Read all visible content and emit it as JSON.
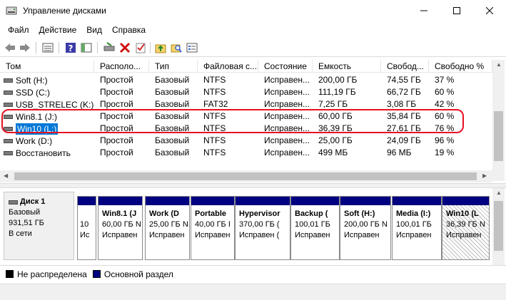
{
  "window": {
    "title": "Управление дисками",
    "icons": {
      "app": "disk-management-icon",
      "minimize": "minimize-icon",
      "maximize": "maximize-icon",
      "close": "close-icon"
    }
  },
  "menu": [
    "Файл",
    "Действие",
    "Вид",
    "Справка"
  ],
  "toolbar": {
    "icons": [
      "back-arrow-icon",
      "forward-arrow-icon",
      "properties-list-icon",
      "help-icon",
      "console-tree-icon",
      "connect-drive-icon",
      "delete-icon",
      "check-icon",
      "up-folder-icon",
      "search-folder-icon",
      "list-view-icon"
    ]
  },
  "columns": [
    "Том",
    "Располо...",
    "Тип",
    "Файловая с...",
    "Состояние",
    "Емкость",
    "Свобод...",
    "Свободно %"
  ],
  "volumes": [
    {
      "name": "Soft (H:)",
      "layout": "Простой",
      "type": "Базовый",
      "fs": "NTFS",
      "status": "Исправен...",
      "capacity": "200,00 ГБ",
      "free": "74,55 ГБ",
      "free_pct": "37 %"
    },
    {
      "name": "SSD (C:)",
      "layout": "Простой",
      "type": "Базовый",
      "fs": "NTFS",
      "status": "Исправен...",
      "capacity": "111,19 ГБ",
      "free": "66,72 ГБ",
      "free_pct": "60 %"
    },
    {
      "name": "USB_STRELEC (K:)",
      "layout": "Простой",
      "type": "Базовый",
      "fs": "FAT32",
      "status": "Исправен...",
      "capacity": "7,25 ГБ",
      "free": "3,08 ГБ",
      "free_pct": "42 %"
    },
    {
      "name": "Win8.1 (J:)",
      "layout": "Простой",
      "type": "Базовый",
      "fs": "NTFS",
      "status": "Исправен...",
      "capacity": "60,00 ГБ",
      "free": "35,84 ГБ",
      "free_pct": "60 %"
    },
    {
      "name": "Win10 (L:)",
      "layout": "Простой",
      "type": "Базовый",
      "fs": "NTFS",
      "status": "Исправен...",
      "capacity": "36,39 ГБ",
      "free": "27,61 ГБ",
      "free_pct": "76 %",
      "selected": true
    },
    {
      "name": "Work (D:)",
      "layout": "Простой",
      "type": "Базовый",
      "fs": "NTFS",
      "status": "Исправен...",
      "capacity": "25,00 ГБ",
      "free": "24,09 ГБ",
      "free_pct": "96 %"
    },
    {
      "name": "Восстановить",
      "layout": "Простой",
      "type": "Базовый",
      "fs": "NTFS",
      "status": "Исправен...",
      "capacity": "499 МБ",
      "free": "96 МБ",
      "free_pct": "19 %"
    }
  ],
  "disk": {
    "name": "Диск 1",
    "type": "Базовый",
    "size": "931,51 ГБ",
    "state": "В сети",
    "partitions": [
      {
        "name": "",
        "size": "10",
        "status": "Ис",
        "hatched": false
      },
      {
        "name": "Win8.1 (J",
        "size": "60,00 ГБ N",
        "status": "Исправен",
        "hatched": false
      },
      {
        "name": "Work (D",
        "size": "25,00 ГБ N",
        "status": "Исправен",
        "hatched": false
      },
      {
        "name": "Portable",
        "size": "40,00 ГБ I",
        "status": "Исправен",
        "hatched": false
      },
      {
        "name": "Hypervisor",
        "size": "370,00 ГБ (",
        "status": "Исправен (",
        "hatched": false
      },
      {
        "name": "Backup (",
        "size": "100,01 ГБ",
        "status": "Исправен",
        "hatched": false
      },
      {
        "name": "Soft (H:)",
        "size": "200,00 ГБ N",
        "status": "Исправен",
        "hatched": false
      },
      {
        "name": "Media (I:)",
        "size": "100,01 ГБ",
        "status": "Исправен",
        "hatched": false
      },
      {
        "name": "Win10 (L",
        "size": "36,39 ГБ N",
        "status": "Исправен",
        "hatched": true
      }
    ]
  },
  "legend": [
    {
      "label": "Не распределена",
      "color": "#000000"
    },
    {
      "label": "Основной раздел",
      "color": "#000080"
    }
  ]
}
